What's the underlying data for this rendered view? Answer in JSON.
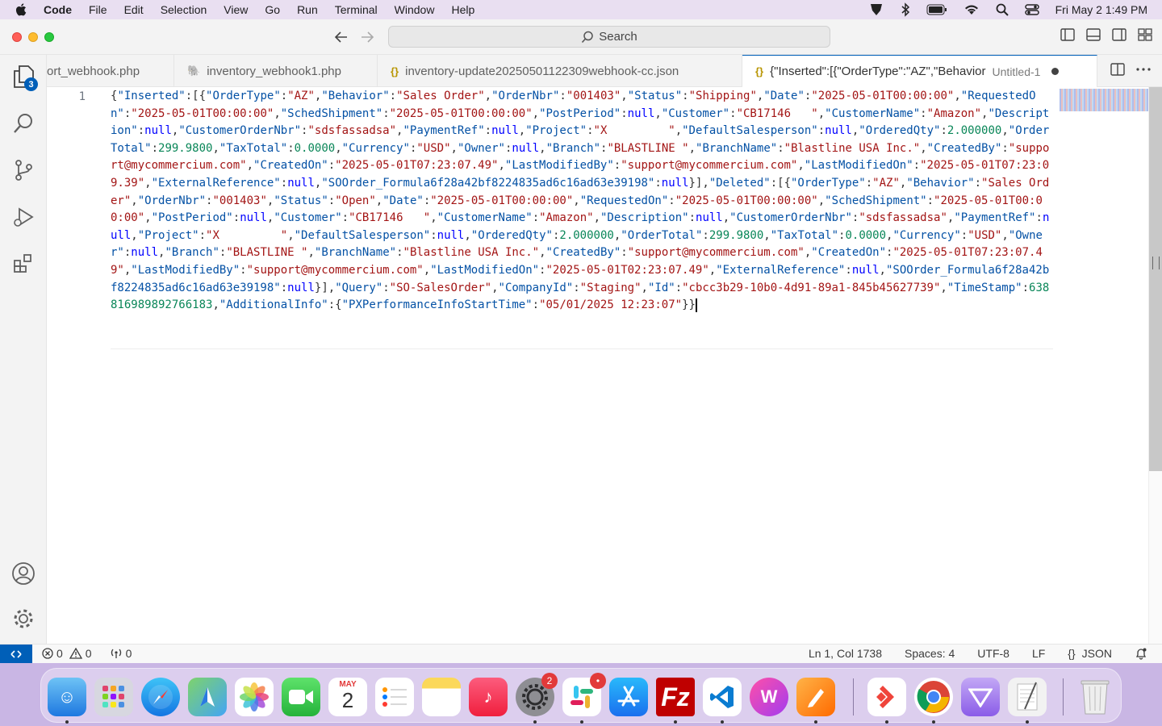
{
  "menubar": {
    "app_name": "Code",
    "items": [
      "File",
      "Edit",
      "Selection",
      "View",
      "Go",
      "Run",
      "Terminal",
      "Window",
      "Help"
    ],
    "clock": "Fri May 2  1:49 PM"
  },
  "titlebar": {
    "search_placeholder": "Search"
  },
  "activitybar": {
    "explorer_badge": "3"
  },
  "tabs": [
    {
      "label": "ort_webhook.php",
      "icon": "php-icon"
    },
    {
      "label": "inventory_webhook1.php",
      "icon": "php-icon"
    },
    {
      "label": "inventory-update20250501122309webhook-cc.json",
      "icon": "json-icon"
    },
    {
      "label": "{\"Inserted\":[{\"OrderType\":\"AZ\",\"Behavior",
      "suffix": "Untitled-1",
      "icon": "json-icon",
      "active": true,
      "dirty": true
    }
  ],
  "editor": {
    "line_numbers": [
      "1"
    ],
    "language": "JSON"
  },
  "statusbar": {
    "errors": "0",
    "warnings": "0",
    "ports": "0",
    "position": "Ln 1, Col 1738",
    "spaces": "Spaces: 4",
    "encoding": "UTF-8",
    "eol": "LF",
    "language": "JSON"
  },
  "dock": {
    "calendar_month": "MAY",
    "calendar_day": "2",
    "settings_badge": "2",
    "slack_badge": "•"
  },
  "colors": {
    "accent": "#005fb8",
    "json_key": "#0451a5",
    "json_string": "#a31515",
    "json_number": "#098658",
    "json_keyword": "#0000ff"
  }
}
